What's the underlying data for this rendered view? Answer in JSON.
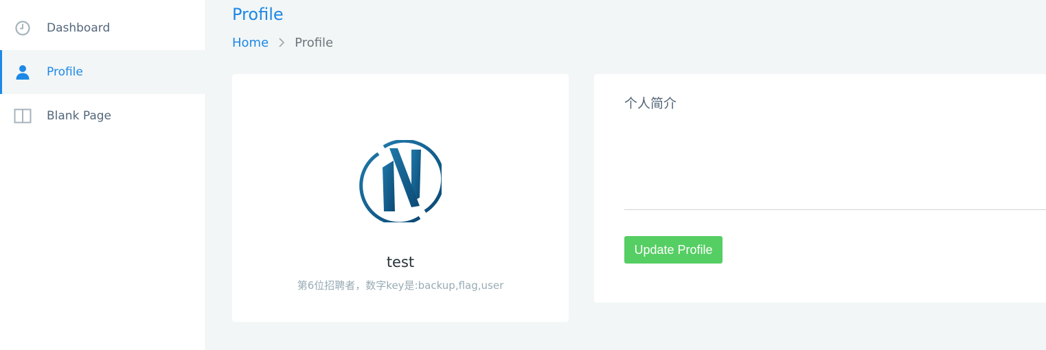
{
  "sidebar": {
    "items": [
      {
        "label": "Dashboard",
        "icon": "clock-icon",
        "active": false
      },
      {
        "label": "Profile",
        "icon": "user-icon",
        "active": true
      },
      {
        "label": "Blank Page",
        "icon": "columns-icon",
        "active": false
      }
    ]
  },
  "header": {
    "title": "Profile",
    "breadcrumb": {
      "home": "Home",
      "separator_icon": "chevron-right-icon",
      "current": "Profile"
    }
  },
  "profile_card": {
    "logo_icon": "n-circle-logo",
    "username": "test",
    "subtitle": "第6位招聘者，数字key是:backup,flag,user"
  },
  "form": {
    "bio_label": "个人简介",
    "bio_value": "",
    "submit_label": "Update Profile"
  },
  "colors": {
    "accent": "#1e88e5",
    "success": "#55ce63",
    "background": "#f2f6f6",
    "text": "#54667a",
    "muted": "#99abb4",
    "logo_dark": "#0c4a75",
    "logo_light": "#1f77a8"
  }
}
